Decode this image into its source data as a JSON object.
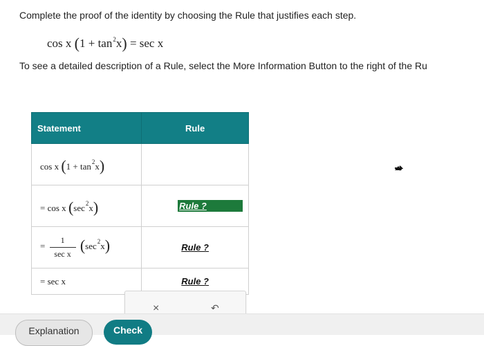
{
  "instructions": {
    "line1": "Complete the proof of the identity by choosing the Rule that justifies each step.",
    "line2": "To see a detailed description of a Rule, select the More Information Button to the right of the Ru"
  },
  "identity": {
    "left": "cos x",
    "inner": "1 + tan",
    "power": "2",
    "var": "x",
    "right": "= sec x"
  },
  "table": {
    "headers": {
      "statement": "Statement",
      "rule": "Rule"
    },
    "rows": [
      {
        "prefix": "",
        "func": "cos x",
        "inner_fn": "1 + tan",
        "power": "2",
        "var": "x",
        "rule": ""
      },
      {
        "prefix": "=",
        "func": "cos x",
        "inner_fn": "sec",
        "power": "2",
        "var": "x",
        "rule": "Rule ?"
      },
      {
        "prefix": "=",
        "numerator": "1",
        "denominator": "sec x",
        "inner_fn": "sec",
        "power": "2",
        "var": "x",
        "rule": "Rule ?"
      },
      {
        "prefix": "=",
        "expr": "sec x",
        "rule": "Rule ?"
      }
    ]
  },
  "toolbar": {
    "clear_symbol": "×",
    "undo_symbol": "↶"
  },
  "buttons": {
    "explanation": "Explanation",
    "check": "Check"
  },
  "colors": {
    "header_bg": "#127f86",
    "selected_rule_bg": "#1d7a3b",
    "check_bg": "#117c84"
  },
  "icons": {
    "clear": "close-icon",
    "undo": "undo-icon",
    "cursor": "mouse-pointer-icon"
  }
}
